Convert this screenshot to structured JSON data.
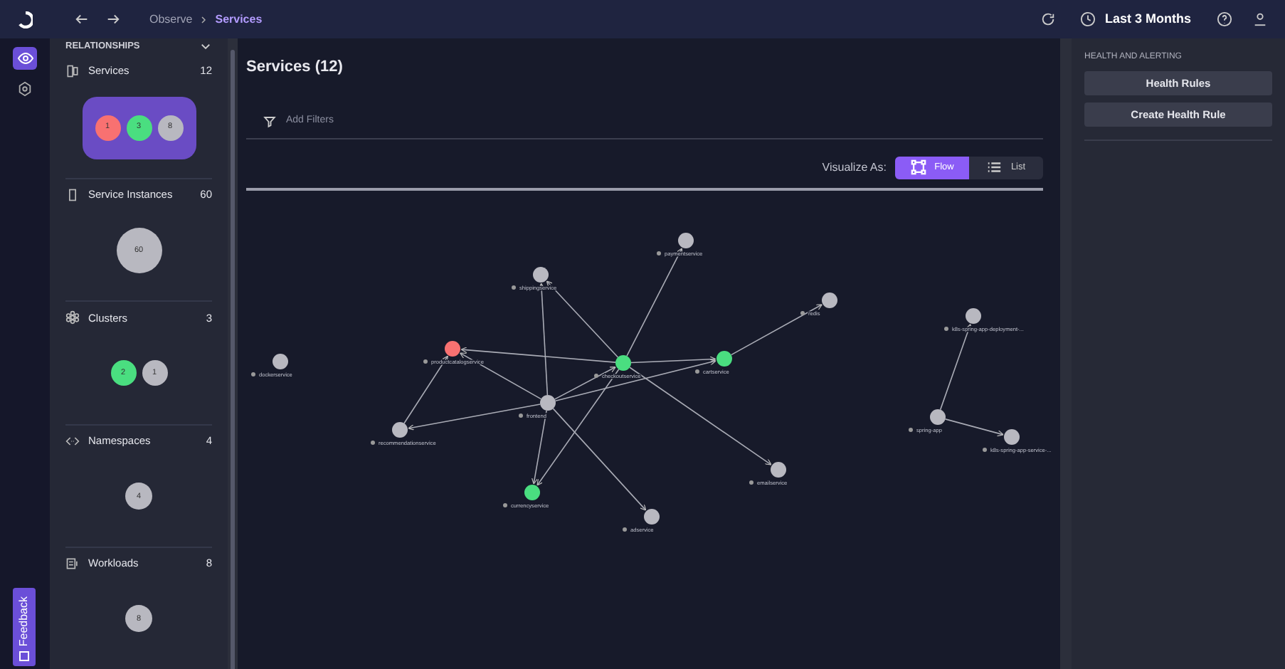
{
  "topbar": {
    "breadcrumb": [
      {
        "label": "Observe",
        "selected": false
      },
      {
        "label": "Services",
        "selected": true
      }
    ],
    "time_range": "Last 3 Months"
  },
  "rail": [
    {
      "kind": "eye",
      "selected": true
    },
    {
      "kind": "gear",
      "selected": false
    }
  ],
  "sidebar": {
    "heading": "RELATIONSHIPS",
    "sections": [
      {
        "kind": "services",
        "title": "Services",
        "count": "12",
        "selected": true,
        "bubbles": [
          {
            "value": "1",
            "color": "#f87171"
          },
          {
            "value": "3",
            "color": "#4ade80"
          },
          {
            "value": "8",
            "color": "#b8b8c0"
          }
        ]
      },
      {
        "kind": "instances",
        "title": "Service Instances",
        "count": "60",
        "selected": false,
        "bubbles": [
          {
            "value": "60",
            "color": "#b8b8c0"
          }
        ]
      },
      {
        "kind": "clusters",
        "title": "Clusters",
        "count": "3",
        "selected": false,
        "bubbles": [
          {
            "value": "2",
            "color": "#4ade80"
          },
          {
            "value": "1",
            "color": "#b8b8c0"
          }
        ]
      },
      {
        "kind": "namespaces",
        "title": "Namespaces",
        "count": "4",
        "selected": false,
        "bubbles": [
          {
            "value": "4",
            "color": "#b8b8c0"
          }
        ]
      },
      {
        "kind": "workloads",
        "title": "Workloads",
        "count": "8",
        "selected": false,
        "bubbles": [
          {
            "value": "8",
            "color": "#b8b8c0"
          }
        ]
      }
    ]
  },
  "feedback": "Feedback",
  "main": {
    "title": "Services (12)",
    "filter_placeholder": "Add Filters",
    "visualize_label": "Visualize As:",
    "views": [
      {
        "kind": "flow",
        "label": "Flow",
        "selected": true
      },
      {
        "kind": "list",
        "label": "List",
        "selected": false
      }
    ],
    "nodes": [
      {
        "label": "shippingservice",
        "color": "#b8b8c0"
      },
      {
        "label": "paymentservice",
        "color": "#b8b8c0"
      },
      {
        "label": "redis",
        "color": "#b8b8c0"
      },
      {
        "label": "productcatalogservice",
        "color": "#f87171"
      },
      {
        "label": "checkoutservice",
        "color": "#4ade80"
      },
      {
        "label": "cartservice",
        "color": "#4ade80"
      },
      {
        "label": "frontend",
        "color": "#b8b8c0"
      },
      {
        "label": "recommendationservice",
        "color": "#b8b8c0"
      },
      {
        "label": "currencyservice",
        "color": "#4ade80"
      },
      {
        "label": "adservice",
        "color": "#b8b8c0"
      },
      {
        "label": "emailservice",
        "color": "#b8b8c0"
      },
      {
        "label": "dockerservice",
        "color": "#b8b8c0"
      },
      {
        "label": "k8s-spring-app-deployment-...",
        "color": "#b8b8c0"
      },
      {
        "label": "spring-app",
        "color": "#b8b8c0"
      },
      {
        "label": "k8s-spring-app-service-...",
        "color": "#b8b8c0"
      }
    ]
  },
  "right": {
    "heading": "HEALTH AND ALERTING",
    "buttons": [
      "Health Rules",
      "Create Health Rule"
    ]
  }
}
